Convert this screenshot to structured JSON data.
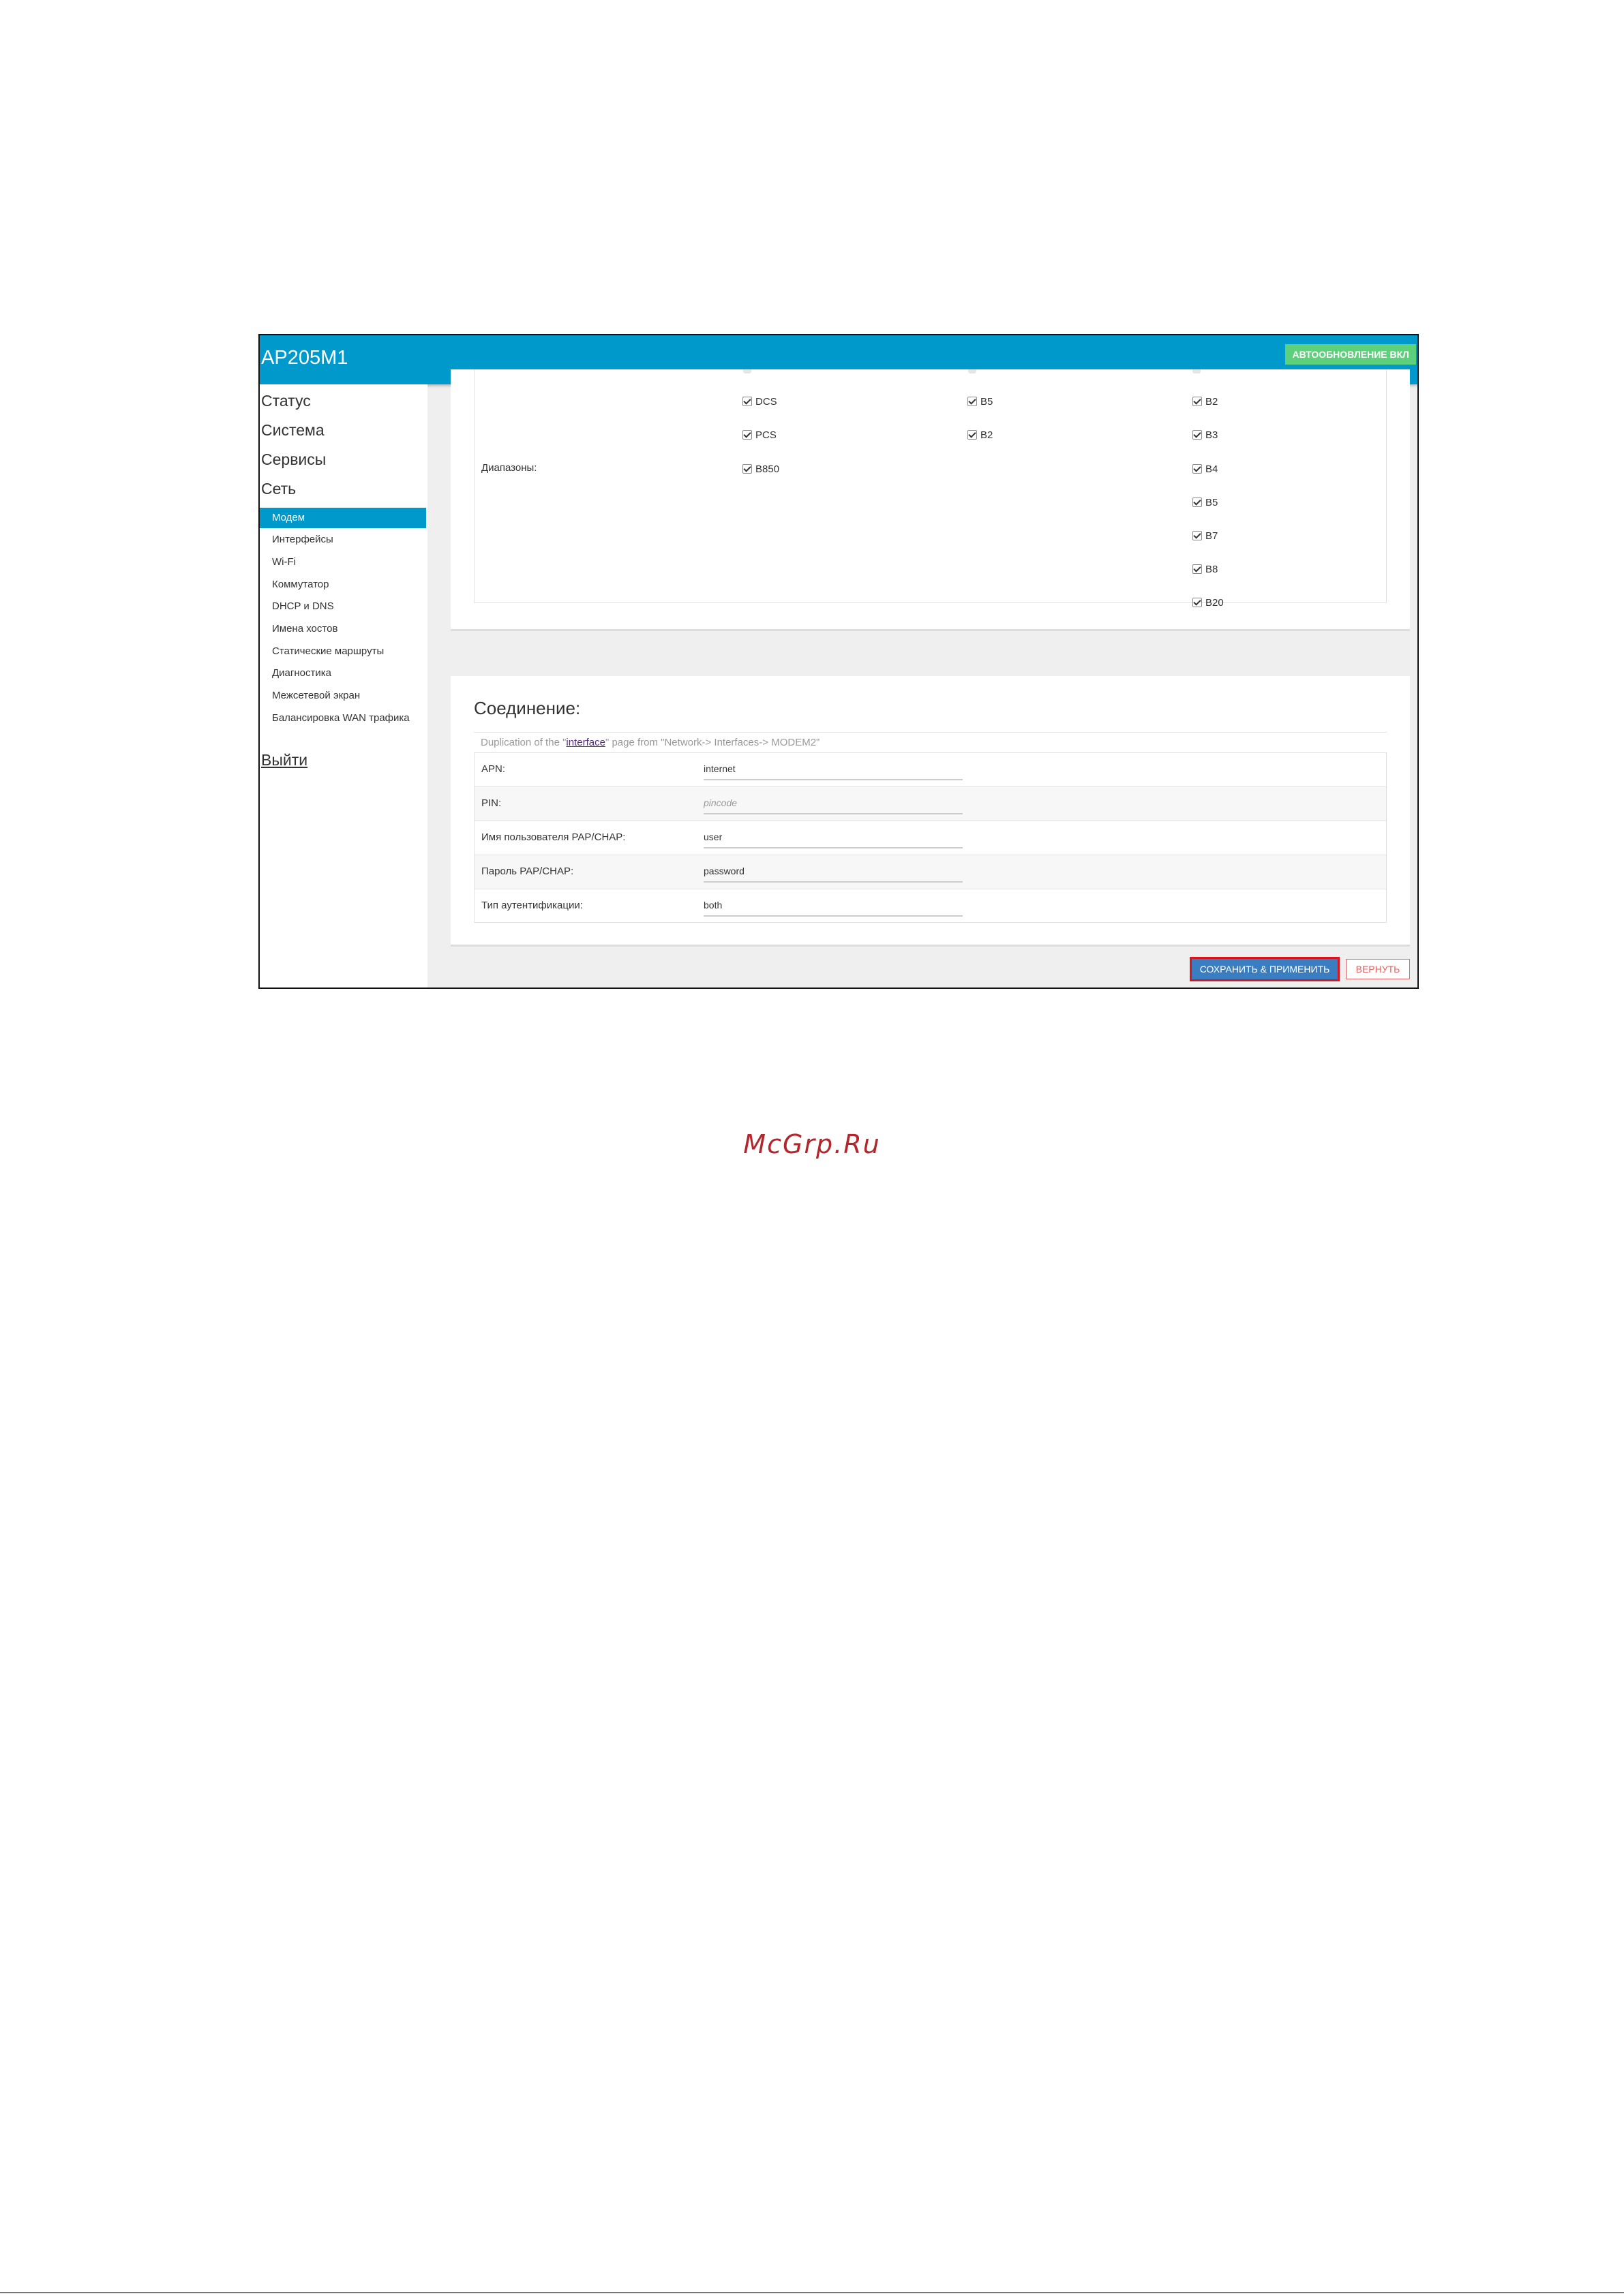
{
  "header": {
    "title": "AP205M1",
    "auto_update_label": "АВТООБНОВЛЕНИЕ ВКЛ"
  },
  "sidebar": {
    "top_items": [
      "Статус",
      "Система",
      "Сервисы",
      "Сеть"
    ],
    "sub_items": [
      "Модем",
      "Интерфейсы",
      "Wi-Fi",
      "Коммутатор",
      "DHCP и DNS",
      "Имена хостов",
      "Статические маршруты",
      "Диагностика",
      "Межсетевой экран",
      "Балансировка WAN трафика"
    ],
    "active_sub": "Модем",
    "logout": "Выйти"
  },
  "bands": {
    "label": "Диапазоны:",
    "columns": [
      [
        "DCS",
        "PCS",
        "B850"
      ],
      [
        "B5",
        "B2"
      ],
      [
        "B2",
        "B3",
        "B4",
        "B5",
        "B7",
        "B8",
        "B20"
      ]
    ],
    "all_checked": true
  },
  "connection": {
    "title": "Соединение:",
    "dup_prefix": "Duplication of the \"",
    "dup_link": "interface",
    "dup_suffix": "\" page from \"Network-> Interfaces-> MODEM2\"",
    "fields": [
      {
        "label": "APN:",
        "value": "internet",
        "placeholder": ""
      },
      {
        "label": "PIN:",
        "value": "",
        "placeholder": "pincode"
      },
      {
        "label": "Имя пользователя PAP/CHAP:",
        "value": "user",
        "placeholder": ""
      },
      {
        "label": "Пароль PAP/CHAP:",
        "value": "password",
        "placeholder": ""
      },
      {
        "label": "Тип аутентификации:",
        "value": "both",
        "placeholder": ""
      }
    ]
  },
  "actions": {
    "save_apply": "СОХРАНИТЬ & ПРИМЕНИТЬ",
    "revert": "ВЕРНУТЬ"
  },
  "watermark": "McGrp.Ru",
  "colors": {
    "header": "#0099cc",
    "auto_update": "#5cd07a",
    "save": "#3a7ec1",
    "highlight": "#d8141c",
    "revert": "#e06666",
    "watermark": "#b3262c"
  }
}
